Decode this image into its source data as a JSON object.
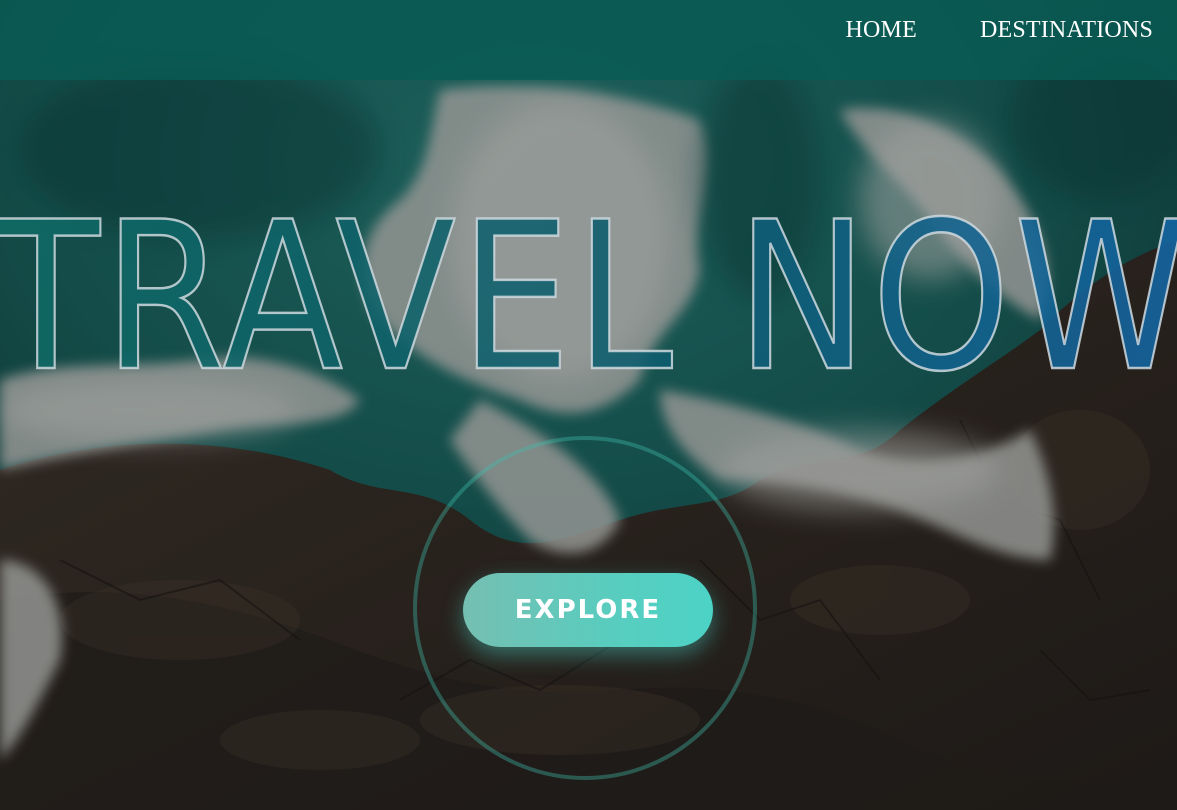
{
  "nav": {
    "links": [
      {
        "label": "HOME"
      },
      {
        "label": "DESTINATIONS"
      }
    ]
  },
  "hero": {
    "headline": "TRAVEL NOW",
    "cta_label": "EXPLORE",
    "background_image": "aerial view of ocean waves crashing on rocky coastline"
  },
  "colors": {
    "navbar": "#085c54",
    "headline_gradient_start": "#0f6a64",
    "headline_gradient_end": "#1466a6",
    "cta_gradient_start": "#75bfb2",
    "cta_gradient_end": "#4cd3c6",
    "ring": "#40beaa"
  }
}
